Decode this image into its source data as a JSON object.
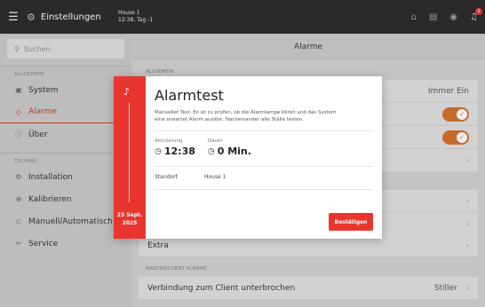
{
  "topbar": {
    "app_title": "Einstellungen",
    "house_name": "House 1",
    "house_time": "12:38, Tag -1",
    "bell_count": "1"
  },
  "sidebar": {
    "search_placeholder": "Suchen",
    "section_general": "ALLGEMEIN",
    "items_general": [
      {
        "label": "System",
        "icon": "system-icon"
      },
      {
        "label": "Alarme",
        "icon": "alarm-icon"
      },
      {
        "label": "Über",
        "icon": "info-icon"
      }
    ],
    "section_technik": "TECHNIK",
    "items_technik": [
      {
        "label": "Installation",
        "icon": "installation-icon"
      },
      {
        "label": "Kalibrieren",
        "icon": "calibrate-icon"
      },
      {
        "label": "Manuell/Automatisch",
        "icon": "manual-auto-icon"
      },
      {
        "label": "Service",
        "icon": "service-icon"
      }
    ]
  },
  "main": {
    "header": "Alarme",
    "section_general": "ALLGEMEIN",
    "row1_value": "Immer Ein",
    "row_extra": "Extra",
    "section_master": "MASTER/CLIENT ALARME",
    "row_client": "Verbindung zum Client unterbrochen",
    "row_client_value": "Stiller"
  },
  "modal": {
    "title": "Alarmtest",
    "description": "Manueller Test. Es ist zu prüfen, ob die Alarmlampe blinkt und das System eine erwartet Alarm auslöst. Nacheinander alle Ställe testen.",
    "activation_label": "Aktivierung",
    "activation_value": "12:38",
    "duration_label": "Dauer",
    "duration_value": "0 Min.",
    "location_label": "Standort",
    "location_value": "House 1",
    "date_line1": "23 Sept.",
    "date_line2": "2025",
    "confirm_label": "Bestätigen"
  },
  "colors": {
    "accent": "#e8362f",
    "toggle": "#c46a2a"
  }
}
